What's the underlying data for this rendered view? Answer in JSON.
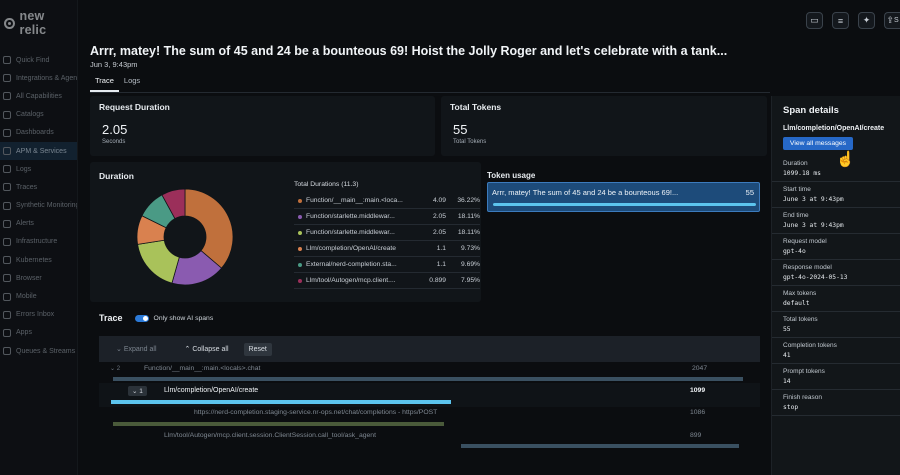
{
  "app": {
    "brand": "new relic"
  },
  "sidebar": {
    "items": [
      {
        "label": "Quick Find",
        "icon": "search-icon"
      },
      {
        "label": "Integrations & Agents",
        "icon": "plus-icon"
      },
      {
        "label": "All Capabilities",
        "icon": "grid-icon"
      },
      {
        "label": "Catalogs",
        "icon": "catalog-icon"
      },
      {
        "label": "Dashboards",
        "icon": "dashboard-icon"
      },
      {
        "label": "APM & Services",
        "icon": "globe-icon",
        "active": true
      },
      {
        "label": "Logs",
        "icon": "logs-icon"
      },
      {
        "label": "Traces",
        "icon": "traces-icon"
      },
      {
        "label": "Synthetic Monitoring",
        "icon": "synthetic-icon"
      },
      {
        "label": "Alerts",
        "icon": "bell-icon"
      },
      {
        "label": "Infrastructure",
        "icon": "server-icon"
      },
      {
        "label": "Kubernetes",
        "icon": "kubernetes-icon"
      },
      {
        "label": "Browser",
        "icon": "browser-icon"
      },
      {
        "label": "Mobile",
        "icon": "mobile-icon"
      },
      {
        "label": "Errors Inbox",
        "icon": "inbox-icon"
      },
      {
        "label": "Apps",
        "icon": "apps-icon"
      },
      {
        "label": "Queues & Streams",
        "icon": "queue-icon"
      }
    ]
  },
  "topbar": {
    "icons": [
      "chat-icon",
      "notes-icon",
      "ai-assistant-icon",
      "share-icon"
    ],
    "share_label": "S"
  },
  "header": {
    "title": "Arrr, matey! The sum of 45 and 24 be a bounteous 69! Hoist the Jolly Roger and let's celebrate with a tank...",
    "subtitle": "Jun 3, 9:43pm"
  },
  "tabs": [
    {
      "label": "Trace",
      "active": true
    },
    {
      "label": "Logs",
      "active": false
    }
  ],
  "request_duration": {
    "title": "Request Duration",
    "value": "2.05",
    "unit": "Seconds"
  },
  "total_tokens": {
    "title": "Total Tokens",
    "value": "55",
    "unit": "Total Tokens"
  },
  "duration": {
    "title": "Duration",
    "table_title": "Total Durations (11.3)",
    "rows": [
      {
        "name": "Function/__main__:main.<loca...",
        "value": "4.09",
        "pct": "36.22%",
        "color": "#c0703c"
      },
      {
        "name": "Function/starlette.middlewar...",
        "value": "2.05",
        "pct": "18.11%",
        "color": "#8a5bb0"
      },
      {
        "name": "Function/starlette.middlewar...",
        "value": "2.05",
        "pct": "18.11%",
        "color": "#a9c25a"
      },
      {
        "name": "Llm/completion/OpenAI/create",
        "value": "1.1",
        "pct": "9.73%",
        "color": "#d9814f"
      },
      {
        "name": "External/nerd-completion.sta...",
        "value": "1.1",
        "pct": "9.69%",
        "color": "#4a9a85"
      },
      {
        "name": "Llm/tool/Autogen/mcp.client....",
        "value": "0.899",
        "pct": "7.95%",
        "color": "#9b2f5a"
      }
    ]
  },
  "chart_data": {
    "type": "pie",
    "title": "Duration",
    "categories": [
      "Function/__main__:main.<loca...",
      "Function/starlette.middlewar...",
      "Function/starlette.middlewar...",
      "Llm/completion/OpenAI/create",
      "External/nerd-completion.sta...",
      "Llm/tool/Autogen/mcp.client...."
    ],
    "values": [
      4.09,
      2.05,
      2.05,
      1.1,
      1.1,
      0.899
    ],
    "colors": [
      "#c0703c",
      "#8a5bb0",
      "#a9c25a",
      "#d9814f",
      "#4a9a85",
      "#9b2f5a"
    ]
  },
  "token_usage": {
    "title": "Token usage",
    "row_label": "Arrr, matey! The sum of 45 and 24 be a bounteous 69!...",
    "row_value": "55",
    "bar_fraction": 1.0
  },
  "trace": {
    "title": "Trace",
    "toggle_label": "Only show AI spans",
    "expand_all": "Expand all",
    "collapse_all": "Collapse all",
    "reset": "Reset",
    "rows": [
      {
        "badge": "2",
        "name": "Function/__main__:main.<locals>.chat",
        "duration": "2047"
      },
      {
        "badge": "1",
        "name": "Llm/completion/OpenAI/create",
        "duration": "1099"
      },
      {
        "name": "https://nerd-completion.staging-service.nr-ops.net/chat/completions - https/POST",
        "duration": "1086"
      },
      {
        "name": "Llm/tool/Autogen/mcp.client.session.ClientSession.call_tool/ask_agent",
        "duration": "899"
      }
    ]
  },
  "span_details": {
    "title": "Span details",
    "span_name": "Llm/completion/OpenAI/create",
    "view_button": "View all messages",
    "fields": [
      {
        "label": "Duration",
        "value": "1099.18 ms"
      },
      {
        "label": "Start time",
        "value": "June 3 at 9:43pm"
      },
      {
        "label": "End time",
        "value": "June 3 at 9:43pm"
      },
      {
        "label": "Request model",
        "value": "gpt-4o"
      },
      {
        "label": "Response model",
        "value": "gpt-4o-2024-05-13"
      },
      {
        "label": "Max tokens",
        "value": "default"
      },
      {
        "label": "Total tokens",
        "value": "55"
      },
      {
        "label": "Completion tokens",
        "value": "41"
      },
      {
        "label": "Prompt tokens",
        "value": "14"
      },
      {
        "label": "Finish reason",
        "value": "stop"
      }
    ]
  }
}
